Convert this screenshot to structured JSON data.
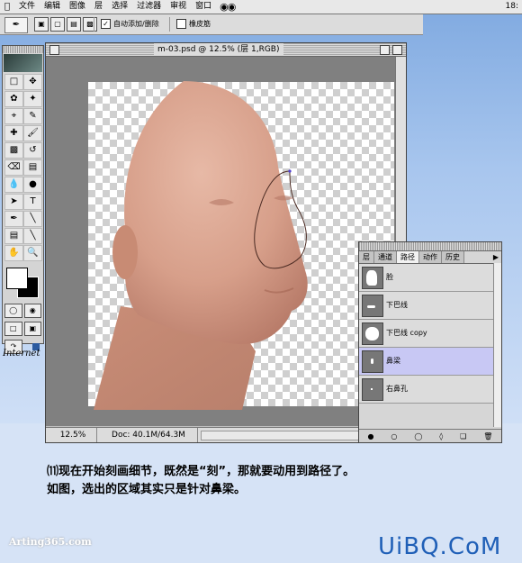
{
  "menubar": {
    "items": [
      "文件",
      "编辑",
      "图像",
      "层",
      "选择",
      "过滤器",
      "审视",
      "窗口"
    ],
    "clock": "18:"
  },
  "optionsbar": {
    "auto_add_delete": "自动添加/删除",
    "rubber_band": "橡皮筋",
    "auto_add_checked": true
  },
  "document": {
    "title": "m-03.psd @ 12.5% (层 1,RGB)",
    "zoom": "12.5%",
    "doc_size": "Doc: 40.1M/64.3M"
  },
  "desktop": {
    "internet_label": "Internet"
  },
  "paths_palette": {
    "tabs": [
      "层",
      "通道",
      "路径",
      "动作",
      "历史"
    ],
    "active_tab": "路径",
    "paths": [
      {
        "name": "脸",
        "selected": false
      },
      {
        "name": "下巴线",
        "selected": false
      },
      {
        "name": "下巴线 copy",
        "selected": false
      },
      {
        "name": "鼻梁",
        "selected": true
      },
      {
        "name": "右鼻孔",
        "selected": false
      }
    ]
  },
  "caption": {
    "line1": "⑾现在开始刻画细节，既然是“刻”，那就要动用到路径了。",
    "line2": "如图，选出的区域其实只是针对鼻梁。"
  },
  "watermarks": {
    "left": "Arting365.com",
    "right": "UiBQ.CoM"
  },
  "colors": {
    "selected_row": "#c8c8f4",
    "skin": "#d9a590",
    "watermark_blue": "#1f5fb7"
  }
}
